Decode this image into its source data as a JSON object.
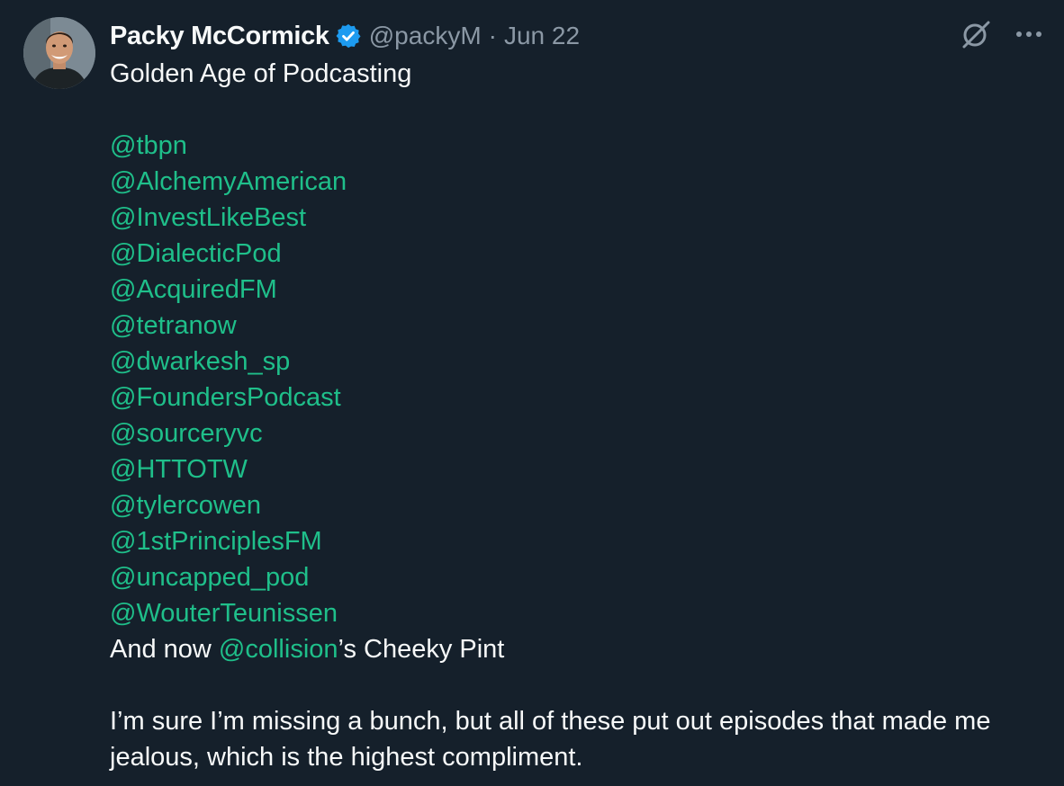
{
  "author": {
    "name": "Packy McCormick",
    "handle": "@packyM",
    "separator": "·",
    "date": "Jun 22"
  },
  "icons": {
    "verified": "verified-badge-icon",
    "grok": "grok-icon",
    "more": "more-options-icon"
  },
  "colors": {
    "background": "#15202b",
    "text": "#f7f9f9",
    "secondary": "#8b98a5",
    "mention": "#1fbf8a",
    "verified": "#1d9bf0"
  },
  "tweet": {
    "heading": "Golden Age of Podcasting",
    "mentions": [
      "@tbpn",
      "@AlchemyAmerican",
      "@InvestLikeBest",
      "@DialecticPod",
      "@AcquiredFM",
      "@tetranow",
      "@dwarkesh_sp",
      "@FoundersPodcast",
      "@sourceryvc",
      "@HTTOTW",
      "@tylercowen",
      "@1stPrinciplesFM",
      "@uncapped_pod",
      "@WouterTeunissen"
    ],
    "and_now_prefix": "And now ",
    "and_now_mention": "@collision",
    "and_now_suffix": "’s Cheeky Pint",
    "closing": "I’m sure I’m missing a bunch, but all of these put out episodes that made me jealous, which is the highest compliment."
  }
}
